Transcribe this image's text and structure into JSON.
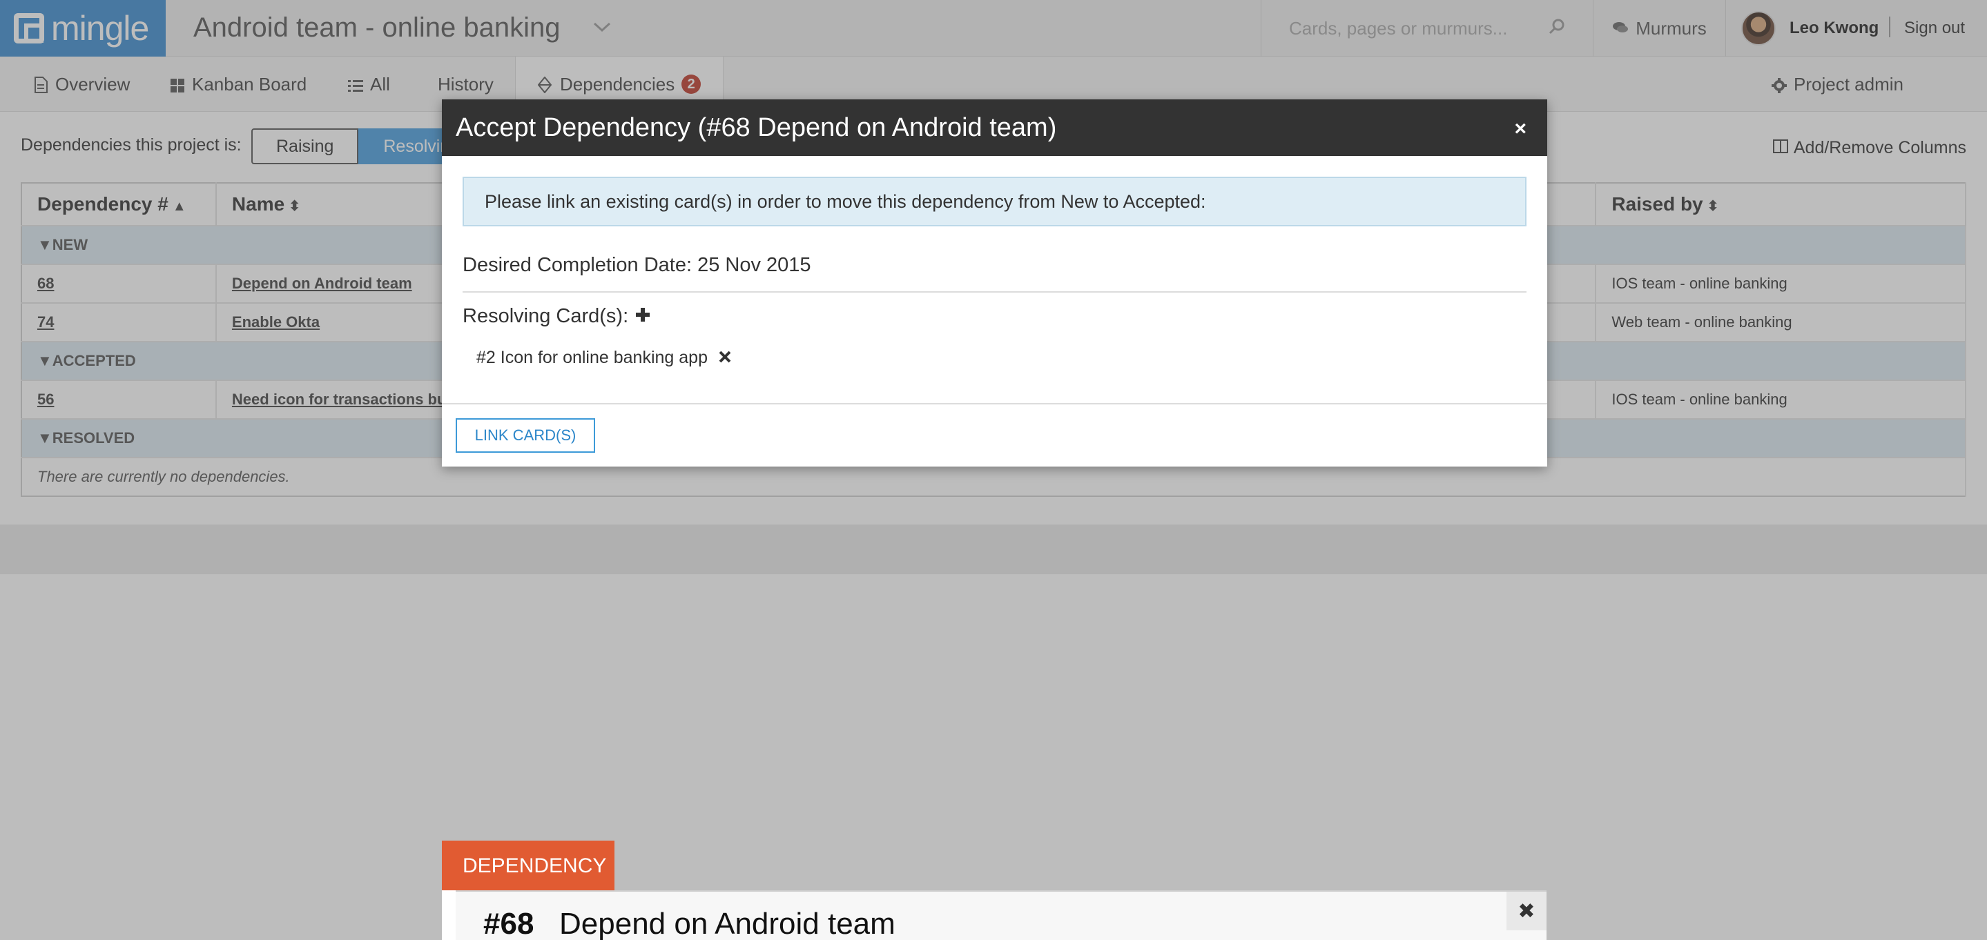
{
  "header": {
    "logo_text": "mingle",
    "project_title": "Android team - online banking",
    "search_placeholder": "Cards, pages or murmurs...",
    "murmurs_label": "Murmurs",
    "user_name": "Leo Kwong",
    "sign_out_label": "Sign out"
  },
  "nav": {
    "tabs": [
      {
        "label": "Overview",
        "icon": "document-icon"
      },
      {
        "label": "Kanban Board",
        "icon": "grid-icon"
      },
      {
        "label": "All",
        "icon": "list-icon"
      },
      {
        "label": "History",
        "icon": ""
      },
      {
        "label": "Dependencies",
        "icon": "diamond-icon",
        "badge": "2"
      }
    ],
    "project_admin_label": "Project admin"
  },
  "toolbar": {
    "label": "Dependencies this project is:",
    "raising_label": "Raising",
    "resolving_label": "Resolving",
    "add_remove_columns_label": "Add/Remove Columns"
  },
  "table": {
    "columns": [
      "Dependency #",
      "Name",
      "Raised by"
    ],
    "groups": [
      {
        "name": "NEW",
        "rows": [
          {
            "number": "68",
            "name": "Depend on Android team",
            "raised_by": "IOS team - online banking"
          },
          {
            "number": "74",
            "name": "Enable Okta",
            "raised_by": "Web team - online banking"
          }
        ]
      },
      {
        "name": "ACCEPTED",
        "rows": [
          {
            "number": "56",
            "name": "Need icon for transactions bu",
            "raised_by": "IOS team - online banking"
          }
        ]
      },
      {
        "name": "RESOLVED",
        "empty_text": "There are currently no dependencies."
      }
    ]
  },
  "modal": {
    "title": "Accept Dependency (#68 Depend on Android team)",
    "close_symbol": "×",
    "info_text": "Please link an existing card(s) in order to move this dependency from New to Accepted:",
    "desired_date_text": "Desired Completion Date: 25 Nov 2015",
    "resolving_label": "Resolving Card(s):",
    "resolving_cards": [
      "#2 Icon for online banking app"
    ],
    "link_button_label": "LINK CARD(S)"
  },
  "dependency_card": {
    "tag_label": "DEPENDENCY",
    "number": "#68",
    "name": "Depend on Android team"
  },
  "colors": {
    "brand_blue": "#3d8dd0",
    "badge_red": "#c0392b",
    "dependency_orange": "#e15b32",
    "modal_header": "#333333",
    "info_bg": "#deedf5"
  }
}
